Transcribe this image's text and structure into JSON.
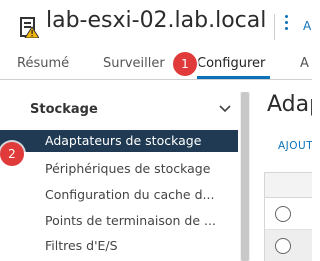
{
  "header": {
    "host_name": "lab-esxi-02.lab.local",
    "actions_label": "A"
  },
  "tabs": [
    {
      "label": "Résumé"
    },
    {
      "label": "Surveiller"
    },
    {
      "label": "Configurer",
      "active": true
    },
    {
      "label": "A"
    }
  ],
  "callouts": [
    "1",
    "2"
  ],
  "sidebar": {
    "section": "Stockage",
    "items": [
      {
        "label": "Adaptateurs de stockage",
        "selected": true
      },
      {
        "label": "Périphériques de stockage"
      },
      {
        "label": "Configuration du cache d..."
      },
      {
        "label": "Points de terminaison de ..."
      },
      {
        "label": "Filtres d'E/S"
      }
    ]
  },
  "content": {
    "title": "Adap",
    "add_label": "AJOUT"
  },
  "colors": {
    "accent": "#0b72b9",
    "selected_bg": "#1f3a52",
    "callout": "#e03a3a"
  }
}
